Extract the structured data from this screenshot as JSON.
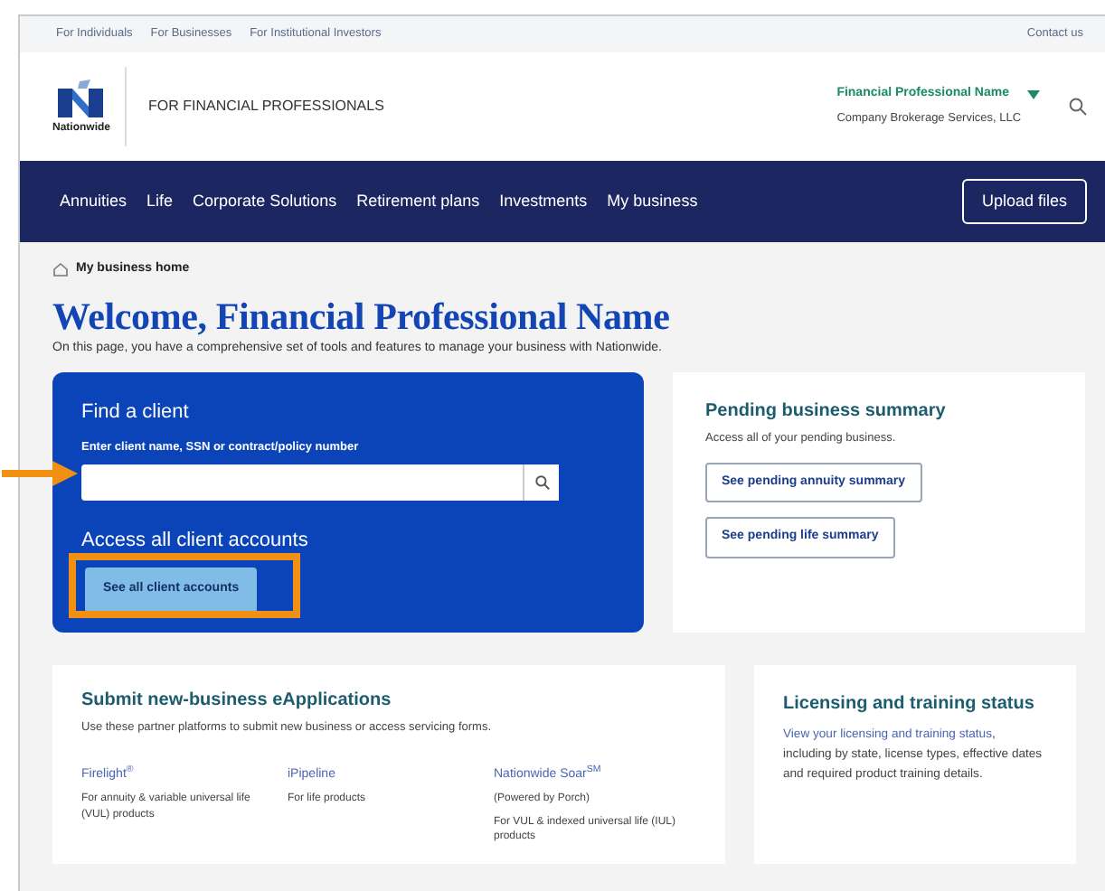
{
  "utility_links": [
    "For Individuals",
    "For Businesses",
    "For Institutional Investors"
  ],
  "contact": "Contact us",
  "brand": {
    "wordmark": "Nationwide",
    "tagline": "FOR FINANCIAL PROFESSIONALS"
  },
  "user": {
    "name": "Financial Professional Name",
    "company": "Company Brokerage Services, LLC"
  },
  "nav": {
    "items": [
      "Annuities",
      "Life",
      "Corporate Solutions",
      "Retirement plans",
      "Investments",
      "My business"
    ],
    "upload": "Upload files"
  },
  "breadcrumb": "My business home",
  "title": "Welcome, Financial Professional Name",
  "intro": "On this page, you have a comprehensive set of tools and features to manage your business with Nationwide.",
  "find_client": {
    "title": "Find a client",
    "label": "Enter client name, SSN or contract/policy number",
    "access_title": "Access all client accounts",
    "button": "See all client accounts"
  },
  "pending": {
    "title": "Pending business summary",
    "text": "Access all of your pending business.",
    "buttons": [
      "See pending annuity summary",
      "See pending life summary"
    ]
  },
  "eapps": {
    "title": "Submit new-business eApplications",
    "text": "Use these partner platforms to submit new business or access servicing forms.",
    "platforms": [
      {
        "name": "Firelight$^{®}$",
        "desc": [
          "For annuity & variable universal life (VUL) products"
        ]
      },
      {
        "name": "iPipeline",
        "desc": [
          "For life products"
        ]
      },
      {
        "name": "Nationwide Soar$^{SM}$",
        "desc": [
          "(Powered by Porch)",
          "For VUL & indexed universal life (IUL) products"
        ]
      }
    ]
  },
  "licensing": {
    "title": "Licensing and training status",
    "link": "View your licensing and training status",
    "text": ", including by state, license types, effective dates and required product training details."
  }
}
